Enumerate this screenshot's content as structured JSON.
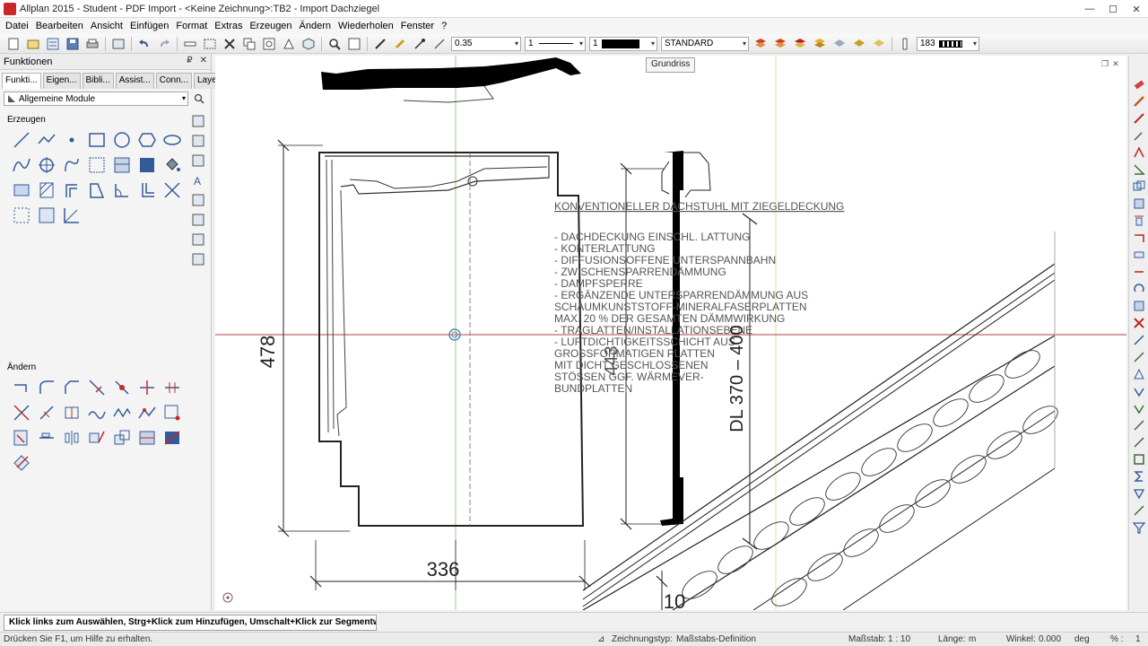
{
  "window": {
    "title": "Allplan 2015 - Student - PDF Import - <Keine Zeichnung>:TB2 - Import Dachziegel",
    "minimize_glyph": "—",
    "maximize_glyph": "☐",
    "close_glyph": "✕"
  },
  "menu": [
    {
      "label": "Datei"
    },
    {
      "label": "Bearbeiten"
    },
    {
      "label": "Ansicht"
    },
    {
      "label": "Einfügen"
    },
    {
      "label": "Format"
    },
    {
      "label": "Extras"
    },
    {
      "label": "Erzeugen"
    },
    {
      "label": "Ändern"
    },
    {
      "label": "Wiederholen"
    },
    {
      "label": "Fenster"
    },
    {
      "label": "?"
    }
  ],
  "toolbar": {
    "pen_thickness": "0.35",
    "line_type": "1",
    "color_number": "1",
    "layer": "STANDARD",
    "zoom_value": "183"
  },
  "panel": {
    "title": "Funktionen",
    "pin_glyph": "₽",
    "close_glyph": "✕",
    "tabs": [
      "Funkti...",
      "Eigen...",
      "Bibli...",
      "Assist...",
      "Conn...",
      "Layer"
    ],
    "module": "Allgemeine Module",
    "section_create": "Erzeugen",
    "section_modify": "Ändern"
  },
  "canvas": {
    "tooltip": "Grundriss",
    "heading": "KONVENTIONELLER DACHSTUHL MIT ZIEGELDECKUNG",
    "notes": [
      "- DACHDECKUNG EINSCHL. LATTUNG",
      "- KONTERLATTUNG",
      "- DIFFUSIONSOFFENE UNTERSPANNBAHN",
      "- ZWISCHENSPARRENDÄMMUNG",
      "- DAMPFSPERRE",
      "- ERGÄNZENDE UNTERSPARRENDÄMMUNG AUS",
      "  SCHAUMKUNSTSTOFF-MINERALFASERPLATTEN",
      "  MAX. 20 % DER GESAMTEN DÄMMWIRKUNG",
      "- TRAGLATTEN/INSTALLATIONSEBENE",
      "- LUFTDICHTIGKEITSSCHICHT AUS",
      "  GROSSFORMATIGEN PLATTEN",
      "  MIT DICHT GESCHLOSSENEN",
      "  STÖSSEN GGF. WÄRMEVER-",
      "  BUNDPLATTEN"
    ],
    "dim_height": "478",
    "dim_width": "336",
    "dim_443": "443",
    "dim_dl": "DL 370 – 400",
    "dim_10": "10"
  },
  "hint": "Klick links zum Auswählen, Strg+Klick zum Hinzufügen, Umschalt+Klick zur Segmentwahl",
  "status": {
    "help": "Drücken Sie F1, um Hilfe zu erhalten.",
    "drawing_type_label": "Zeichnungstyp:",
    "drawing_type": "Maßstabs-Definition",
    "scale_label": "Maßstab:",
    "scale": "1 : 10",
    "length_label": "Länge:",
    "length_unit": "m",
    "angle_label": "Winkel:",
    "angle": "0.000",
    "angle_unit": "deg",
    "percent_label": "% :",
    "percent": "1"
  },
  "colors": {
    "accent_red": "#c82828",
    "guide_green": "#9ac88a",
    "guide_yellow": "#e6df9a",
    "axis_red": "#b04040"
  }
}
